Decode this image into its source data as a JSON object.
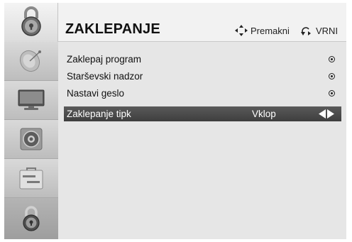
{
  "header": {
    "title": "ZAKLEPANJE",
    "hint_move": "Premakni",
    "hint_back": "VRNI",
    "move_icon": "four-way-arrows-icon",
    "back_icon": "return-icon"
  },
  "sidebar": {
    "items": [
      {
        "name": "lock",
        "icon": "padlock-icon"
      },
      {
        "name": "satellite",
        "icon": "satellite-dish-icon"
      },
      {
        "name": "picture",
        "icon": "tv-screen-icon"
      },
      {
        "name": "audio",
        "icon": "speaker-icon"
      },
      {
        "name": "setup",
        "icon": "toolbox-icon"
      },
      {
        "name": "lock-selected",
        "icon": "padlock-icon"
      }
    ]
  },
  "menu": {
    "items": [
      {
        "label": "Zaklepaj program",
        "indicator": "radio-dot-icon"
      },
      {
        "label": "Starševski nadzor",
        "indicator": "radio-dot-icon"
      },
      {
        "label": "Nastavi geslo",
        "indicator": "radio-dot-icon"
      },
      {
        "label": "Zaklepanje tipk",
        "value": "Vklop",
        "indicator": "left-right-arrows-icon"
      }
    ]
  },
  "colors": {
    "highlight": "#4a4a4a",
    "background": "#e6e6e6",
    "sidebar": "#c9c9c9"
  }
}
